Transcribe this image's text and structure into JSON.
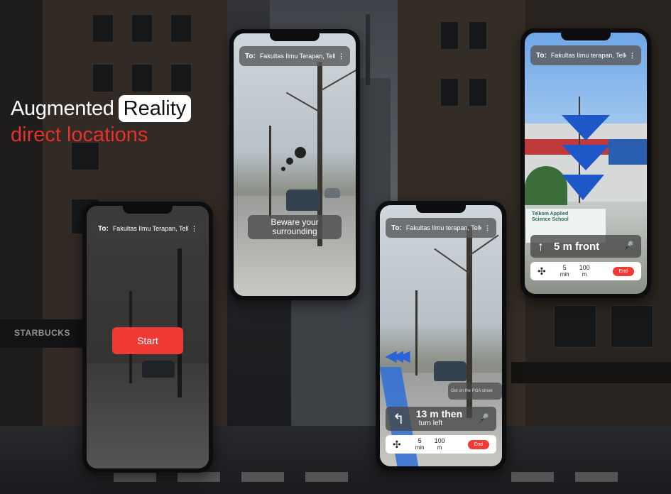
{
  "headline": {
    "word1": "Augmented",
    "word2": "Reality",
    "line2": "direct locations"
  },
  "background": {
    "store_sign": "STARBUCKS"
  },
  "phones": {
    "start": {
      "to_label": "To:",
      "destination": "Fakultas Ilmu Terapan, Telkom",
      "start_label": "Start"
    },
    "warning": {
      "to_label": "To:",
      "destination": "Fakultas Ilmu Terapan, Telkom",
      "message": "Beware your surrounding"
    },
    "turn": {
      "to_label": "To:",
      "destination": "Fakultas Ilmu terapan, Telkom",
      "street_hint": "Get on the PGA street",
      "distance": "13 m then",
      "instruction": "turn left",
      "time_value": "5",
      "time_unit": "min",
      "dist_value": "100",
      "dist_unit": "m",
      "end_label": "End"
    },
    "front": {
      "to_label": "To:",
      "destination": "Fakultas Ilmu terapan, Telkom",
      "sign_text": "Telkom Applied Science School",
      "distance": "5 m front",
      "time_value": "5",
      "time_unit": "min",
      "dist_value": "100",
      "dist_unit": "m",
      "end_label": "End"
    }
  },
  "colors": {
    "accent_red": "#f03a36",
    "arrow_blue": "#1e57c8"
  },
  "icons": {
    "more": "vertical-ellipsis",
    "compass": "compass-rose",
    "mic": "microphone",
    "turn_left": "turn-left-arrow",
    "straight": "up-arrow",
    "chevron": "chevron-down"
  }
}
